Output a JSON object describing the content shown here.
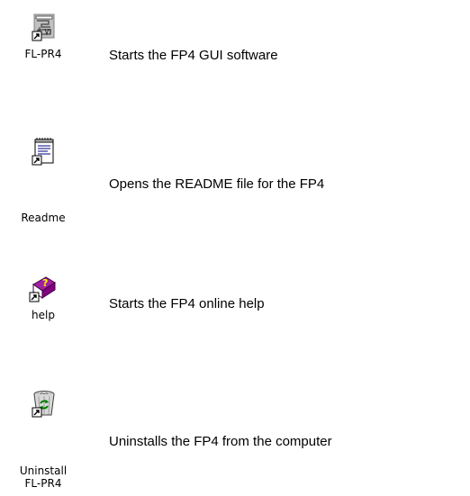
{
  "shortcuts": [
    {
      "icon": "fl-pr4-app-icon",
      "label": "FL-PR4",
      "description": "Starts the FP4 GUI software"
    },
    {
      "icon": "readme-notepad-icon",
      "label": "Readme",
      "description": "Opens the README file for the FP4"
    },
    {
      "icon": "help-book-icon",
      "label": "help",
      "description": "Starts the FP4 online help"
    },
    {
      "icon": "uninstall-recycle-bin-icon",
      "label": "Uninstall\nFL-PR4",
      "description": "Uninstalls the FP4 from the computer"
    }
  ],
  "colors": {
    "shortcut_arrow_bg": "#ffffff",
    "help_book_purple": "#800080",
    "help_question_yellow": "#ffff00",
    "recycle_green": "#008000"
  }
}
